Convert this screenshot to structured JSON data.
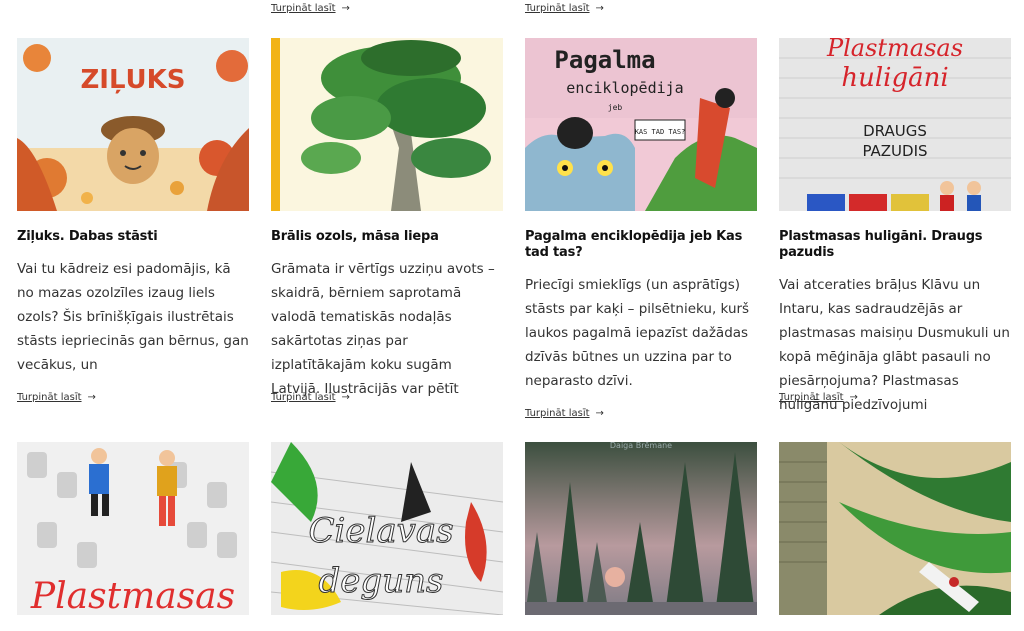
{
  "read_more_label": "Turpināt lasīt",
  "arrow": "→",
  "cards": [
    {
      "title": "Ziļuks. Dabas stāsti",
      "excerpt": "Vai tu kādreiz esi padomājis, kā no mazas ozolzīles izaug liels ozols? Šis brīnišķīgais ilustrētais stāsts iepriecinās gan bērnus, gan vecākus, un",
      "cover_text": "ZIĻUKS"
    },
    {
      "title": "Brālis ozols, māsa liepa",
      "excerpt": "Grāmata ir vērtīgs uzziņu avots – skaidrā, bērniem saprotamā valodā tematiskās nodaļās sakārtotas ziņas par izplatītākajām koku sugām Latvijā. Ilustrācijās var pētīt"
    },
    {
      "title": "Pagalma enciklopēdija jeb Kas tad tas?",
      "excerpt": "Priecīgi smieklīgs (un asprātīgs) stāsts par kaķi – pilsētnieku, kurš laukos pagalmā iepazīst dažādas dzīvās būtnes un uzzina par to neparasto dzīvi.",
      "cover_title": "Pagalma",
      "cover_sub": "enciklopēdija",
      "cover_jeb": "jeb",
      "cover_bubble": "KAS TAD TAS?"
    },
    {
      "title": "Plastmasas huligāni. Draugs pazudis",
      "excerpt": "Vai atceraties brāļus Klāvu un Intaru, kas sadraudzējās ar plastmasas maisiņu Dusmukuli un kopā mēģināja glābt pasauli no piesārņojuma? Plastmasas huligānu piedzīvojumi",
      "cover_line1": "Plastmasas",
      "cover_line2": "huligāni",
      "cover_line3": "DRAUGS",
      "cover_line4": "PAZUDIS"
    }
  ],
  "bottom_covers": [
    {
      "cover_text": "Plastmasas"
    },
    {
      "cover_line1": "Cielavas",
      "cover_line2": "deguns"
    },
    {
      "cover_top": "Daiga Brēmane"
    },
    {}
  ]
}
